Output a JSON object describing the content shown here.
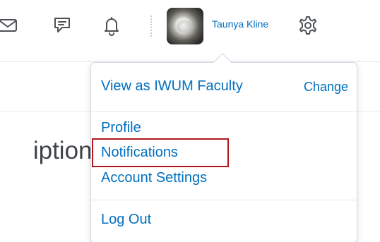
{
  "header": {
    "user_name": "Taunya Kline",
    "icons": {
      "email": "email-icon",
      "message": "message-alerts-icon",
      "notification": "notification-bell-icon",
      "settings": "gear-icon"
    }
  },
  "page": {
    "title_fragment": "iptions"
  },
  "user_menu": {
    "role_label": "View as IWUM Faculty",
    "change_label": "Change",
    "items": [
      "Profile",
      "Notifications",
      "Account Settings"
    ],
    "logout_label": "Log Out"
  },
  "colors": {
    "link": "#006fbf",
    "highlight_border": "#b1161c"
  }
}
